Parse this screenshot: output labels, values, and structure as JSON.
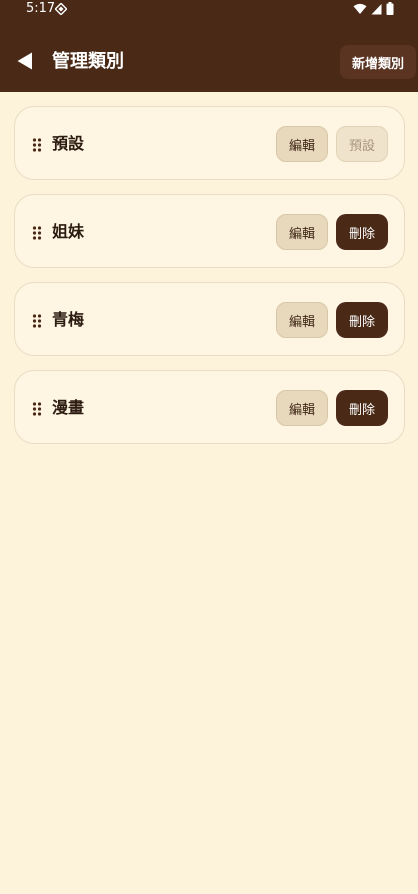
{
  "status_bar": {
    "time": "5:17"
  },
  "app_bar": {
    "title": "管理類別",
    "add_category_label": "新增類別"
  },
  "categories": [
    {
      "name": "預設",
      "edit_label": "編輯",
      "action_label": "預設",
      "action_type": "default"
    },
    {
      "name": "姐妹",
      "edit_label": "編輯",
      "action_label": "刪除",
      "action_type": "delete"
    },
    {
      "name": "青梅",
      "edit_label": "編輯",
      "action_label": "刪除",
      "action_type": "delete"
    },
    {
      "name": "漫畫",
      "edit_label": "編輯",
      "action_label": "刪除",
      "action_type": "delete"
    }
  ],
  "icons": {
    "back": "back-arrow-icon",
    "drag": "drag-handle-icon",
    "wifi": "wifi-icon",
    "signal": "signal-icon",
    "battery": "battery-icon"
  },
  "colors": {
    "primary": "#4A2A17",
    "background": "#FDF3DA",
    "card": "#FEF5E2",
    "edit_button": "#E8D8BC",
    "disabled_text": "#A89581"
  }
}
